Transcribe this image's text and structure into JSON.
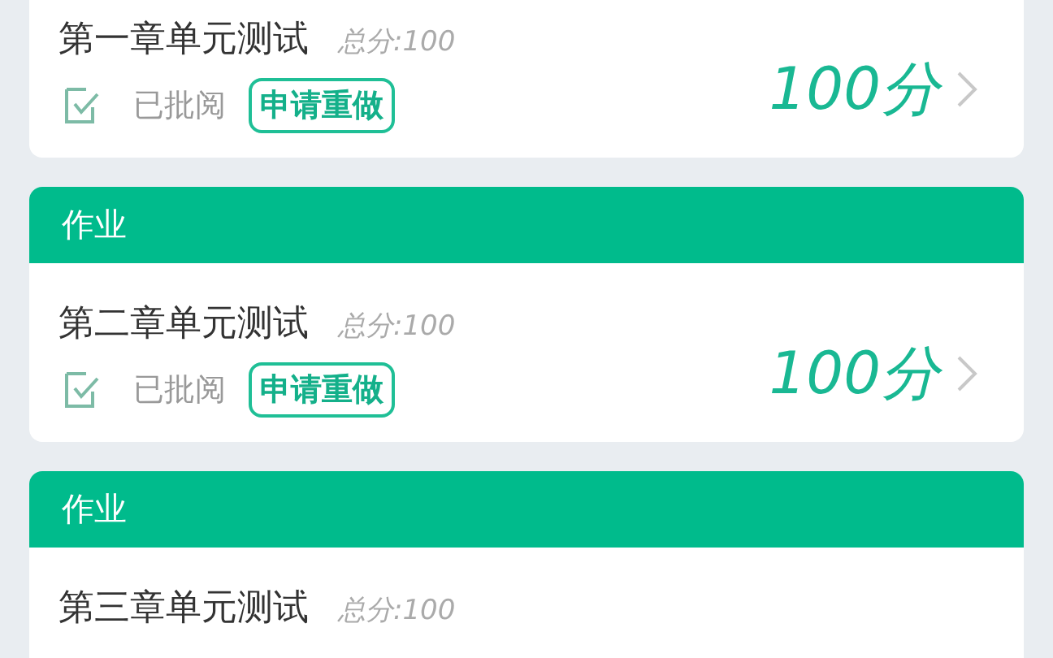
{
  "cards": [
    {
      "title": "第一章单元测试",
      "total_label": "总分:",
      "total": "100",
      "status": "已批阅",
      "action": "申请重做",
      "score": "100分"
    },
    {
      "header": "作业",
      "title": "第二章单元测试",
      "total_label": "总分:",
      "total": "100",
      "status": "已批阅",
      "action": "申请重做",
      "score": "100分"
    },
    {
      "header": "作业",
      "title": "第三章单元测试",
      "total_label": "总分:",
      "total": "100"
    }
  ]
}
